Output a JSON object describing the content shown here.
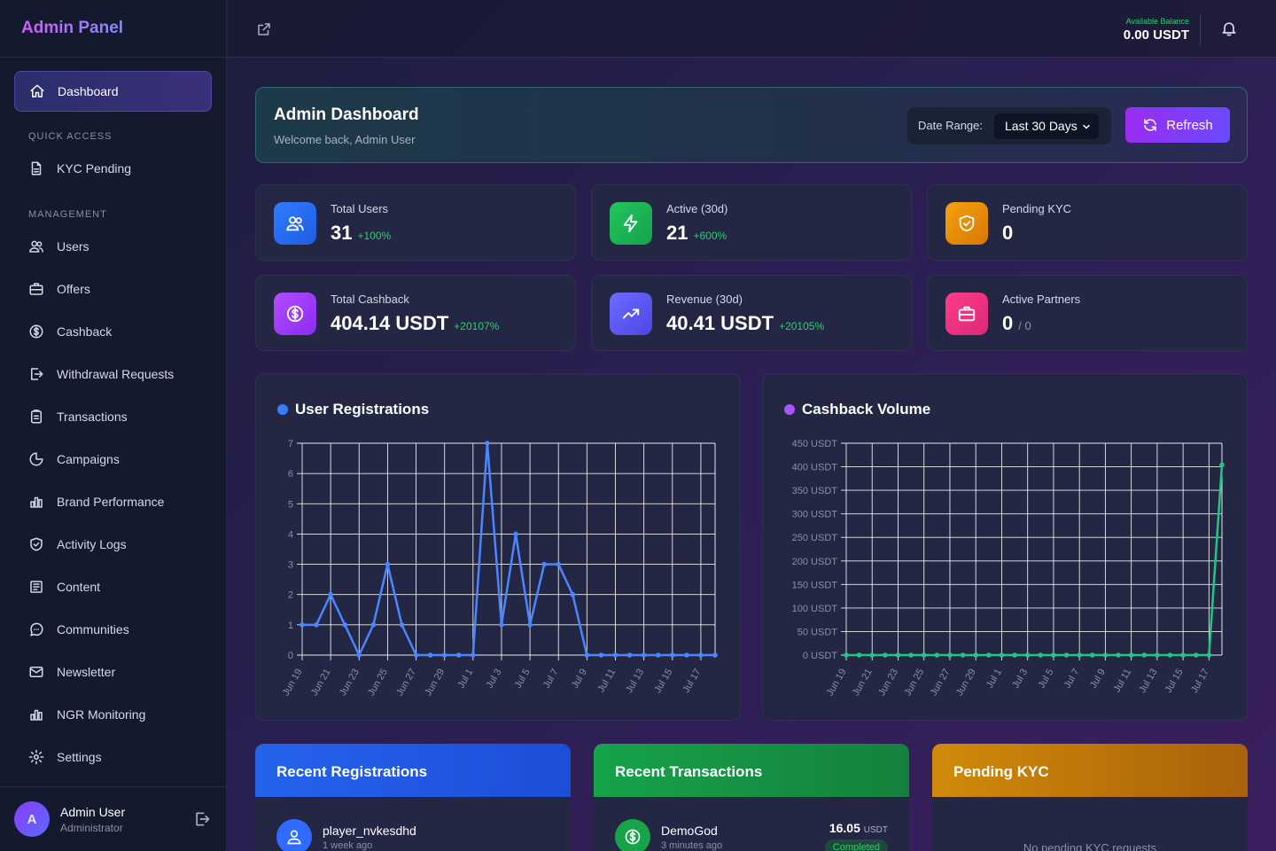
{
  "app": {
    "title": "Admin Panel"
  },
  "sidebar": {
    "dashboard": "Dashboard",
    "quick_access_label": "QUICK ACCESS",
    "kyc_pending": "KYC Pending",
    "management_label": "MANAGEMENT",
    "items": [
      "Users",
      "Offers",
      "Cashback",
      "Withdrawal Requests",
      "Transactions",
      "Campaigns",
      "Brand Performance",
      "Activity Logs",
      "Content",
      "Communities",
      "Newsletter",
      "NGR Monitoring",
      "Settings"
    ],
    "icons": [
      "users-icon",
      "briefcase-icon",
      "dollar-circle-icon",
      "withdraw-icon",
      "clipboard-icon",
      "pie-chart-icon",
      "bar-chart-icon",
      "shield-check-icon",
      "newspaper-icon",
      "message-circle-icon",
      "mail-icon",
      "bar-chart-icon",
      "gear-icon"
    ]
  },
  "user": {
    "initial": "A",
    "name": "Admin User",
    "role": "Administrator"
  },
  "topbar": {
    "balance_label": "Available Balance",
    "balance_value": "0.00 USDT"
  },
  "header": {
    "title": "Admin Dashboard",
    "subtitle": "Welcome back, Admin User",
    "range_label": "Date Range:",
    "range_value": "Last 30 Days",
    "refresh_label": "Refresh"
  },
  "stats": {
    "total_users": {
      "label": "Total Users",
      "value": "31",
      "delta": "+100%"
    },
    "active": {
      "label": "Active (30d)",
      "value": "21",
      "delta": "+600%"
    },
    "pending_kyc": {
      "label": "Pending KYC",
      "value": "0"
    },
    "total_cashback": {
      "label": "Total Cashback",
      "value": "404.14 USDT",
      "delta": "+20107%"
    },
    "revenue": {
      "label": "Revenue (30d)",
      "value": "40.41 USDT",
      "delta": "+20105%"
    },
    "partners": {
      "label": "Active Partners",
      "value": "0",
      "sub": "/ 0"
    }
  },
  "colors": {
    "blue": "#3b7bff",
    "green": "#22c55e",
    "amber": "#f59e0b",
    "purple": "#a855f7",
    "pink": "#ec4899",
    "indigo": "#6366f1"
  },
  "chart_data": [
    {
      "type": "line",
      "title": "User Registrations",
      "color": "#4a86ff",
      "x": [
        "Jun 19",
        "Jun 20",
        "Jun 21",
        "Jun 22",
        "Jun 23",
        "Jun 24",
        "Jun 25",
        "Jun 26",
        "Jun 27",
        "Jun 28",
        "Jun 29",
        "Jun 30",
        "Jul 1",
        "Jul 2",
        "Jul 3",
        "Jul 4",
        "Jul 5",
        "Jul 6",
        "Jul 7",
        "Jul 8",
        "Jul 9",
        "Jul 10",
        "Jul 11",
        "Jul 12",
        "Jul 13",
        "Jul 14",
        "Jul 15",
        "Jul 16",
        "Jul 17",
        "Jul 18"
      ],
      "tick_labels": [
        "Jun 19",
        "Jun 21",
        "Jun 23",
        "Jun 25",
        "Jun 27",
        "Jun 29",
        "Jul 1",
        "Jul 3",
        "Jul 5",
        "Jul 7",
        "Jul 9",
        "Jul 11",
        "Jul 13",
        "Jul 15",
        "Jul 17"
      ],
      "values": [
        1,
        1,
        2,
        1,
        0,
        1,
        3,
        1,
        0,
        0,
        0,
        0,
        0,
        7,
        1,
        4,
        1,
        3,
        3,
        2,
        0,
        0,
        0,
        0,
        0,
        0,
        0,
        0,
        0,
        0
      ],
      "ylim": [
        0,
        7
      ],
      "yticks": [
        "0",
        "1",
        "2",
        "3",
        "4",
        "5",
        "6",
        "7"
      ],
      "grid": true
    },
    {
      "type": "line",
      "title": "Cashback Volume",
      "color": "#22c583",
      "x": [
        "Jun 19",
        "Jun 20",
        "Jun 21",
        "Jun 22",
        "Jun 23",
        "Jun 24",
        "Jun 25",
        "Jun 26",
        "Jun 27",
        "Jun 28",
        "Jun 29",
        "Jun 30",
        "Jul 1",
        "Jul 2",
        "Jul 3",
        "Jul 4",
        "Jul 5",
        "Jul 6",
        "Jul 7",
        "Jul 8",
        "Jul 9",
        "Jul 10",
        "Jul 11",
        "Jul 12",
        "Jul 13",
        "Jul 14",
        "Jul 15",
        "Jul 16",
        "Jul 17",
        "Jul 18"
      ],
      "tick_labels": [
        "Jun 19",
        "Jun 21",
        "Jun 23",
        "Jun 25",
        "Jun 27",
        "Jun 29",
        "Jul 1",
        "Jul 3",
        "Jul 5",
        "Jul 7",
        "Jul 9",
        "Jul 11",
        "Jul 13",
        "Jul 15",
        "Jul 17"
      ],
      "values": [
        0,
        0,
        0,
        0,
        0,
        0,
        0,
        0,
        0,
        0,
        0,
        0,
        0,
        0,
        0,
        0,
        0,
        0,
        0,
        0,
        0,
        0,
        0,
        0,
        0,
        0,
        0,
        0,
        0,
        404.14
      ],
      "ylim": [
        0,
        450
      ],
      "yticks": [
        "0 USDT",
        "50 USDT",
        "100 USDT",
        "150 USDT",
        "200 USDT",
        "250 USDT",
        "300 USDT",
        "350 USDT",
        "400 USDT",
        "450 USDT"
      ],
      "grid": true
    }
  ],
  "recent_registrations": {
    "title": "Recent Registrations",
    "rows": [
      {
        "name": "player_nvkesdhd",
        "time": "1 week ago"
      }
    ]
  },
  "recent_transactions": {
    "title": "Recent Transactions",
    "rows": [
      {
        "name": "DemoGod",
        "time": "3 minutes ago",
        "amount": "16.05",
        "unit": "USDT",
        "status": "Completed"
      }
    ]
  },
  "pending_kyc_panel": {
    "title": "Pending KYC",
    "empty": "No pending KYC requests"
  }
}
